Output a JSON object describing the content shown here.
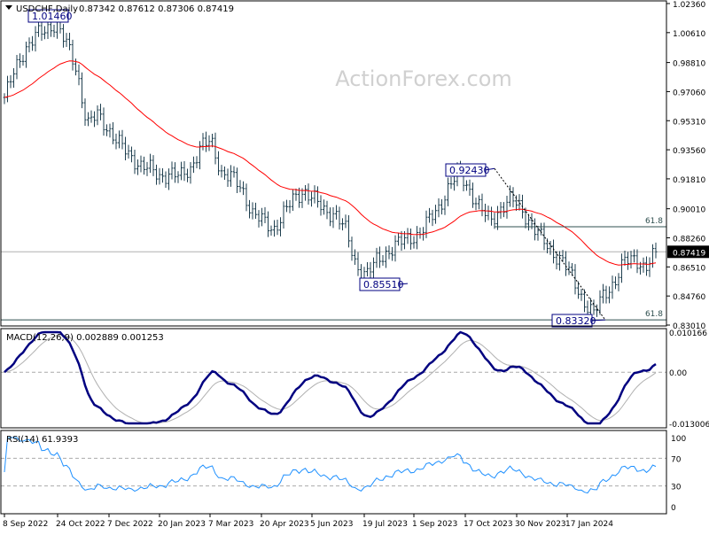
{
  "header": {
    "symbol_label": "USDCHF,Daily",
    "ohlc": "0.87342 0.87612 0.87306 0.87419"
  },
  "watermark": "ActionForex.com",
  "colors": {
    "bars": "#1f3f4f",
    "ma": "#ff0000",
    "macd": "#000080",
    "signal": "#b0b0b0",
    "rsi": "#1e90ff",
    "label_border": "#000080"
  },
  "chart_data": [
    {
      "type": "ohlc",
      "title": "USDCHF,Daily",
      "ylim": [
        0.8301,
        1.0236
      ],
      "y_ticks": [
        "1.02360",
        "1.00610",
        "0.98810",
        "0.97060",
        "0.95310",
        "0.93560",
        "0.91810",
        "0.90010",
        "0.88260",
        "0.86510",
        "0.84760",
        "0.83010"
      ],
      "x_ticks": [
        "8 Sep 2022",
        "24 Oct 2022",
        "7 Dec 2022",
        "20 Jan 2023",
        "7 Mar 2023",
        "20 Apr 2023",
        "5 Jun 2023",
        "19 Jul 2023",
        "1 Sep 2023",
        "17 Oct 2023",
        "30 Nov 2023",
        "17 Jan 2024"
      ],
      "close_path": [
        0.9671,
        0.9831,
        0.9964,
        1.0044,
        1.0071,
        1.0124,
        0.9991,
        0.9831,
        0.9511,
        0.9564,
        0.9484,
        0.9404,
        0.9324,
        0.9271,
        0.9244,
        0.9191,
        0.9218,
        0.9191,
        0.9244,
        0.9378,
        0.9404,
        0.9218,
        0.9191,
        0.9111,
        0.8978,
        0.8925,
        0.8871,
        0.8978,
        0.9058,
        0.9111,
        0.9058,
        0.8978,
        0.8978,
        0.8871,
        0.8658,
        0.8605,
        0.8685,
        0.8738,
        0.8791,
        0.8818,
        0.8845,
        0.8925,
        0.9005,
        0.9138,
        0.9218,
        0.9111,
        0.9005,
        0.8925,
        0.9005,
        0.9058,
        0.9005,
        0.8898,
        0.8818,
        0.8738,
        0.8685,
        0.8578,
        0.8445,
        0.8365,
        0.8498,
        0.8552,
        0.8685,
        0.8711,
        0.8631,
        0.8742
      ],
      "last_price": "0.87419",
      "annotations": [
        {
          "label": "1.01460",
          "value": 1.0146
        },
        {
          "label": "0.92430",
          "value": 0.9243
        },
        {
          "label": "0.85510",
          "value": 0.8551
        },
        {
          "label": "0.83320",
          "value": 0.8332
        }
      ],
      "fib_levels": [
        {
          "label": "61.8",
          "value": 0.8893
        },
        {
          "label": "61.8",
          "value": 0.8332
        }
      ],
      "moving_average": "red line"
    },
    {
      "type": "line",
      "title": "MACD(12,26,9) 0.002889 0.001253",
      "ylim": [
        -0.013006,
        0.010166
      ],
      "y_ticks": [
        "0.010166",
        "0.00",
        "-0.013006"
      ],
      "series": [
        {
          "name": "MACD"
        },
        {
          "name": "Signal"
        }
      ]
    },
    {
      "type": "line",
      "title": "RSI(14) 61.9393",
      "ylim": [
        0,
        100
      ],
      "y_ticks": [
        "100",
        "70",
        "30",
        "0"
      ],
      "levels": [
        70,
        30
      ]
    }
  ]
}
